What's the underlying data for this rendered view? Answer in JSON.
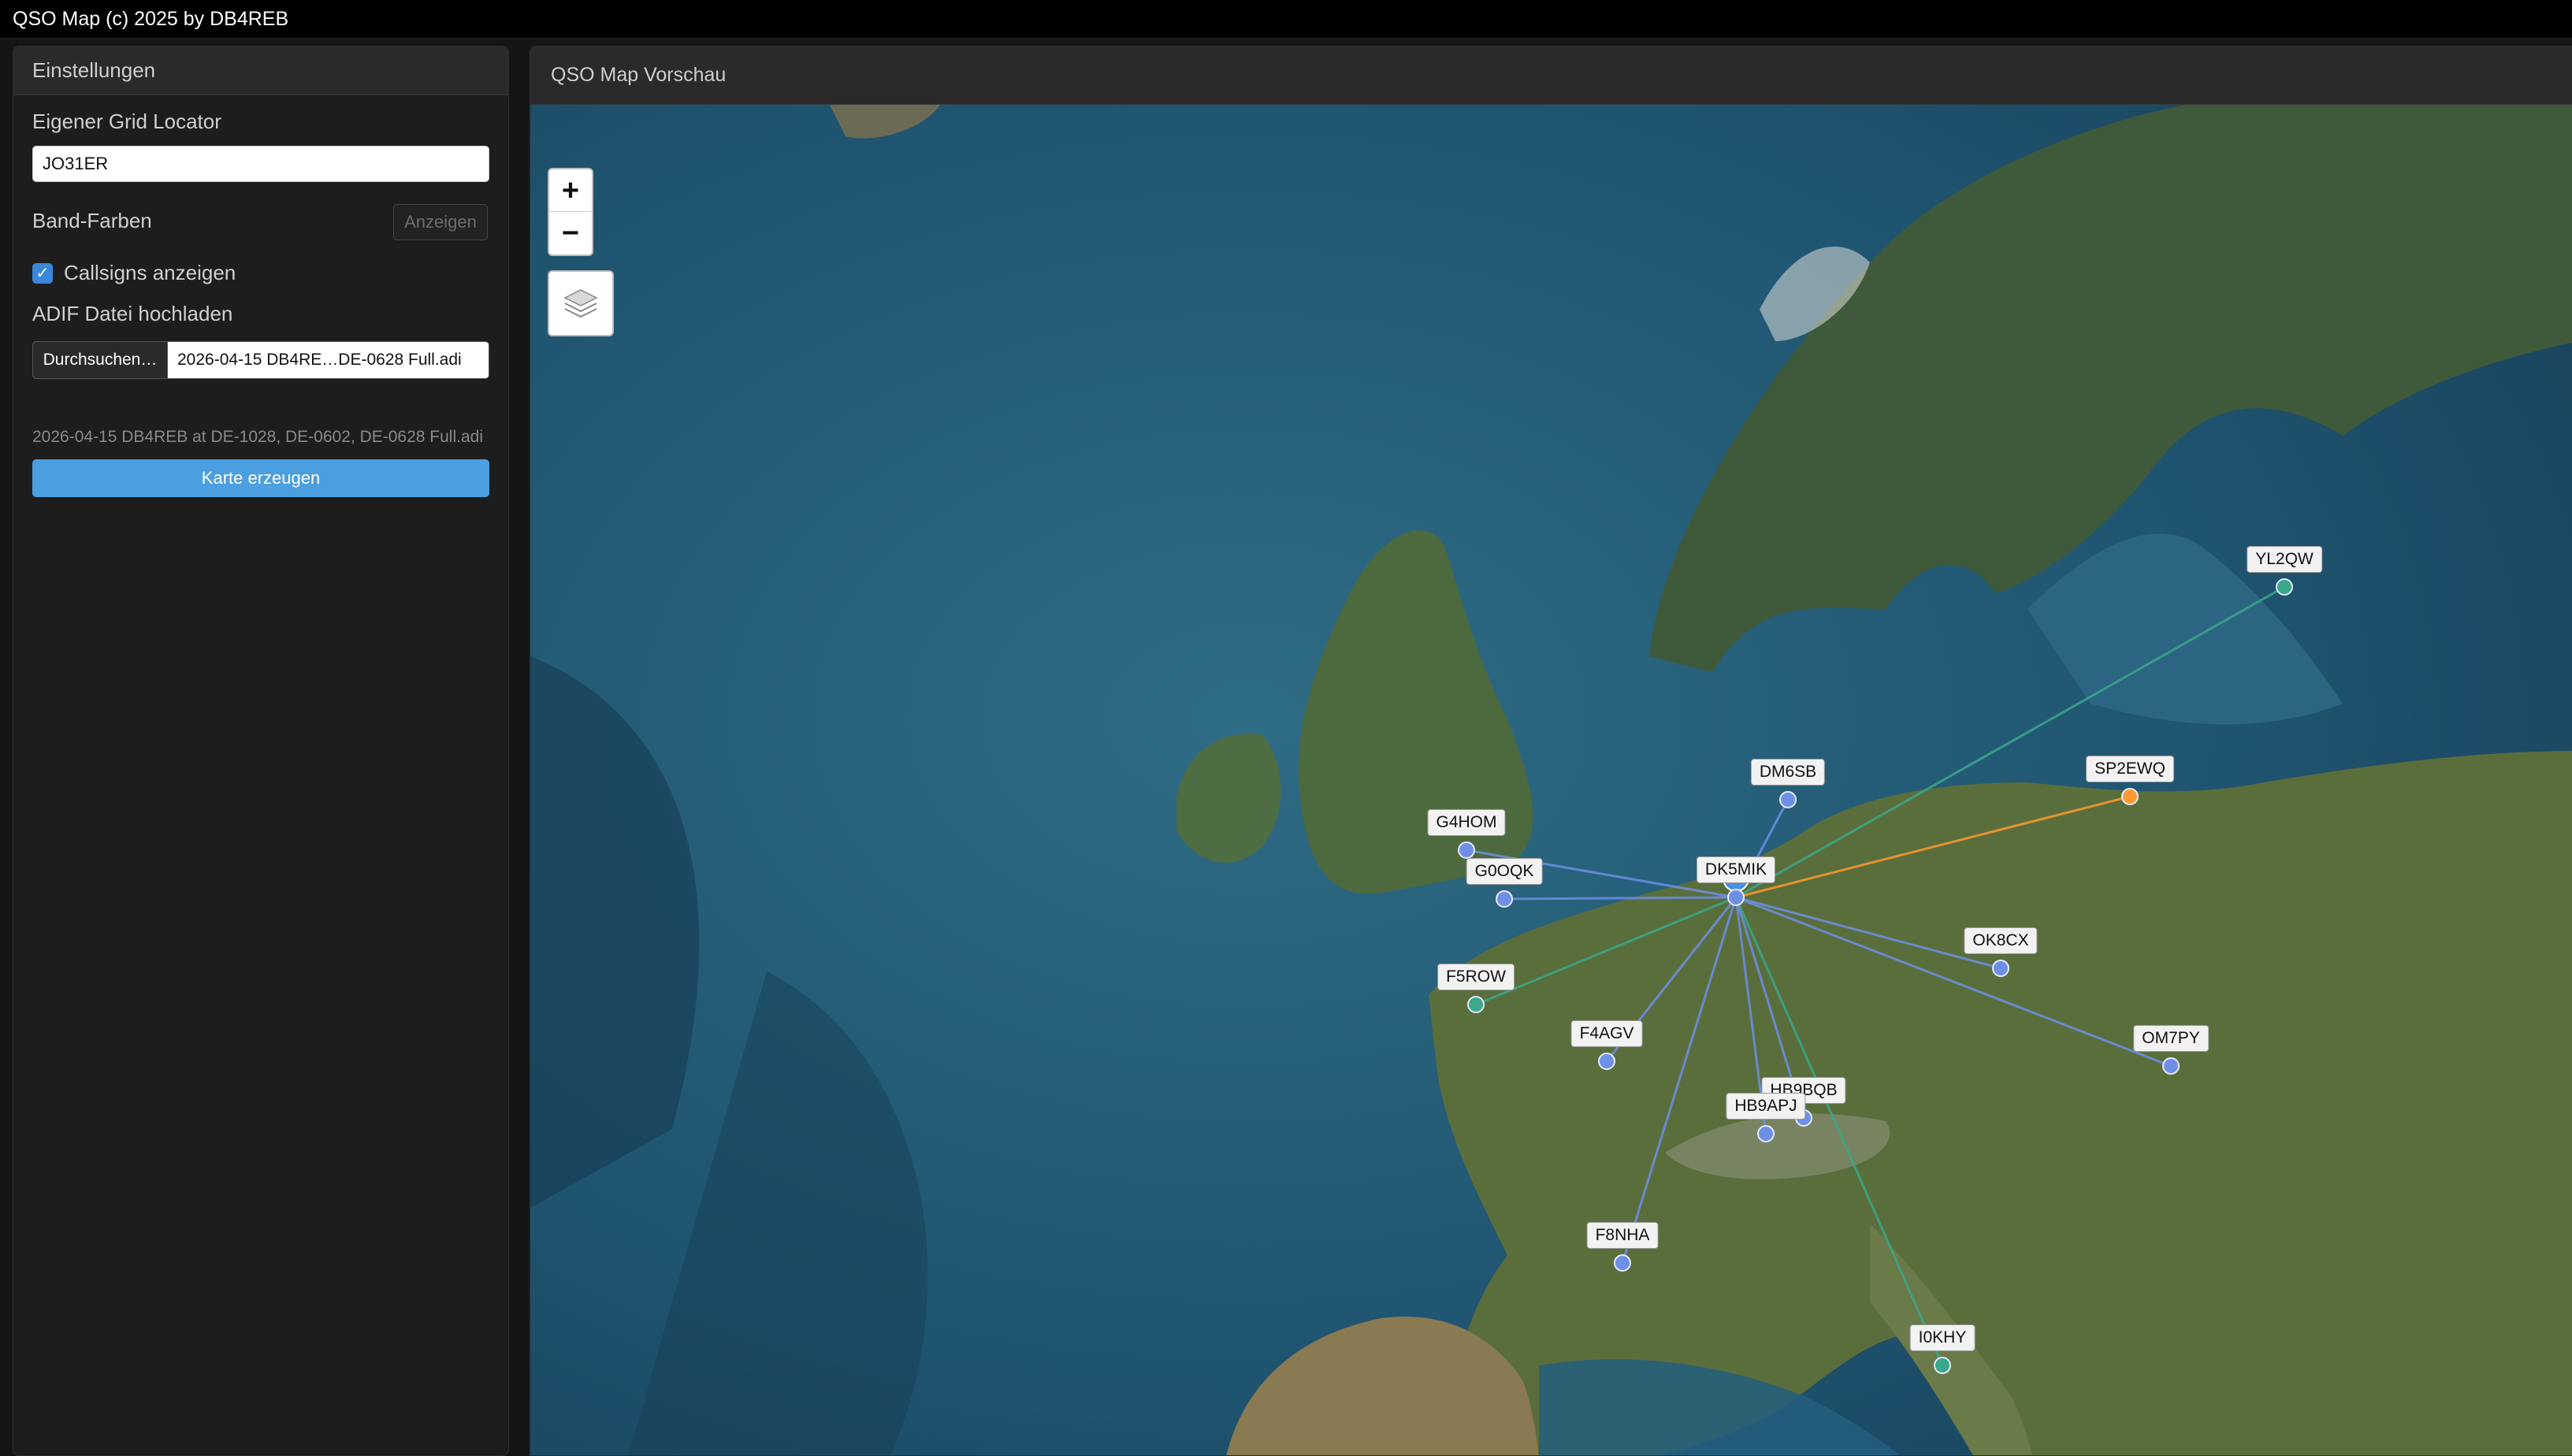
{
  "window": {
    "title": "QSO Map (c) 2025 by DB4REB"
  },
  "settings": {
    "header": "Einstellungen",
    "grid_label": "Eigener Grid Locator",
    "grid_value": "JO31ER",
    "band_colors_label": "Band-Farben",
    "band_colors_button": "Anzeigen",
    "callsigns_label": "Callsigns anzeigen",
    "callsigns_checked": true,
    "adif_label": "ADIF Datei hochladen",
    "browse_button": "Durchsuchen…",
    "file_name": "2026-04-15 DB4RE…DE-0628 Full.adi",
    "file_hint": "2026-04-15 DB4REB at DE-1028, DE-0602, DE-0628 Full.adi",
    "generate_button": "Karte erzeugen"
  },
  "map": {
    "header": "QSO Map Vorschau",
    "zoom_in": "+",
    "zoom_out": "−",
    "layers_icon": "layers-icon",
    "colors": {
      "blue": "#6d8fe6",
      "orange": "#ff9a2e",
      "green": "#3aa88a",
      "home": "#4a90e2"
    },
    "home": {
      "call": "DK5MIK"
    },
    "stations": [
      {
        "call": "YL2QW",
        "color": "green"
      },
      {
        "call": "DM6SB",
        "color": "blue"
      },
      {
        "call": "SP2EWQ",
        "color": "orange"
      },
      {
        "call": "G4HOM",
        "color": "blue"
      },
      {
        "call": "G0OQK",
        "color": "blue"
      },
      {
        "call": "OK8CX",
        "color": "blue"
      },
      {
        "call": "F5ROW",
        "color": "green"
      },
      {
        "call": "F4AGV",
        "color": "blue"
      },
      {
        "call": "OM7PY",
        "color": "blue"
      },
      {
        "call": "HB9BQB",
        "color": "blue"
      },
      {
        "call": "HB9APJ",
        "color": "blue"
      },
      {
        "call": "F8NHA",
        "color": "blue"
      },
      {
        "call": "I0KHY",
        "color": "green"
      }
    ]
  }
}
